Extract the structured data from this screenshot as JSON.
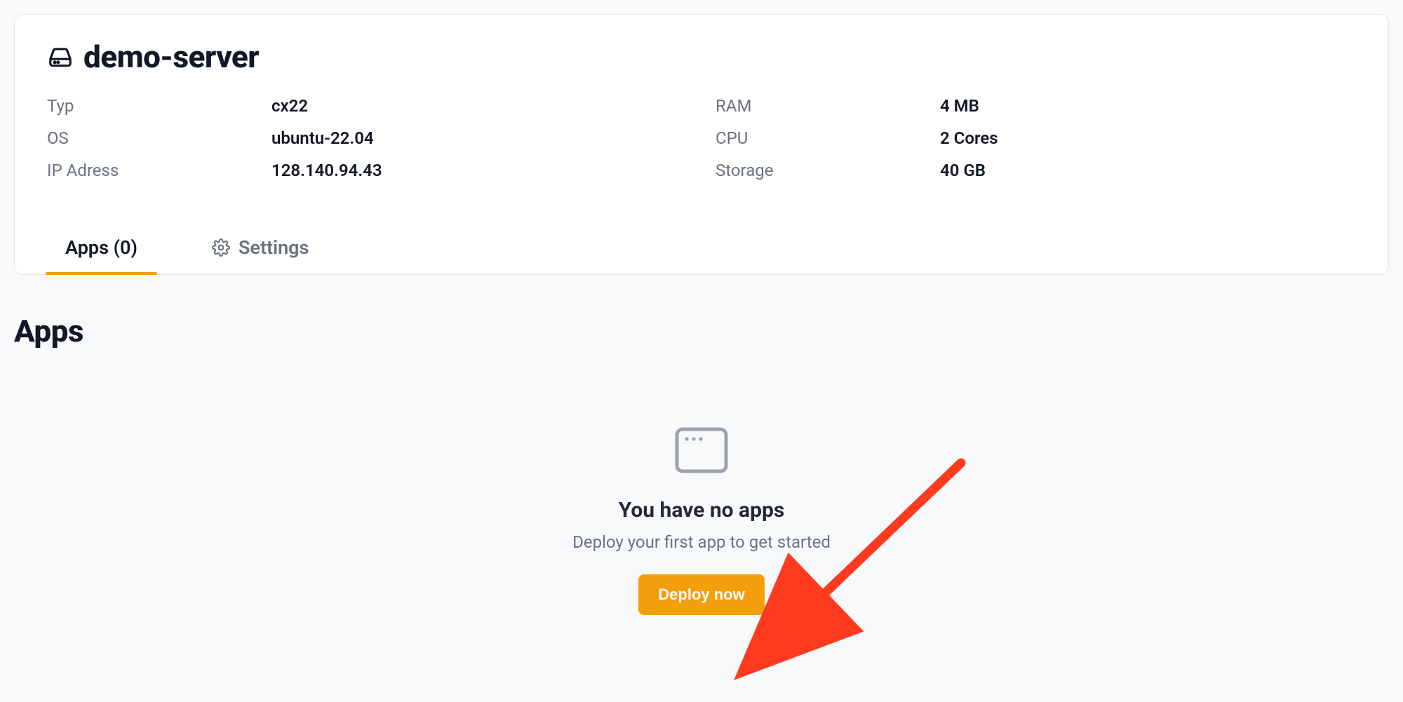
{
  "server": {
    "name": "demo-server",
    "specs_left": [
      {
        "label": "Typ",
        "value": "cx22"
      },
      {
        "label": "OS",
        "value": "ubuntu-22.04"
      },
      {
        "label": "IP Adress",
        "value": "128.140.94.43"
      }
    ],
    "specs_right": [
      {
        "label": "RAM",
        "value": "4 MB"
      },
      {
        "label": "CPU",
        "value": "2 Cores"
      },
      {
        "label": "Storage",
        "value": "40 GB"
      }
    ]
  },
  "tabs": {
    "apps": {
      "label": "Apps (0)",
      "active": true
    },
    "settings": {
      "label": "Settings",
      "active": false
    }
  },
  "section": {
    "heading": "Apps"
  },
  "empty": {
    "title": "You have no apps",
    "subtitle": "Deploy your first app to get started",
    "button": "Deploy now"
  },
  "icons": {
    "server": "hard-drive-icon",
    "settings": "gear-icon",
    "app_window": "app-window-icon"
  },
  "annotation": {
    "type": "arrow",
    "color": "#ff3b1f",
    "target": "deploy-now-button"
  }
}
